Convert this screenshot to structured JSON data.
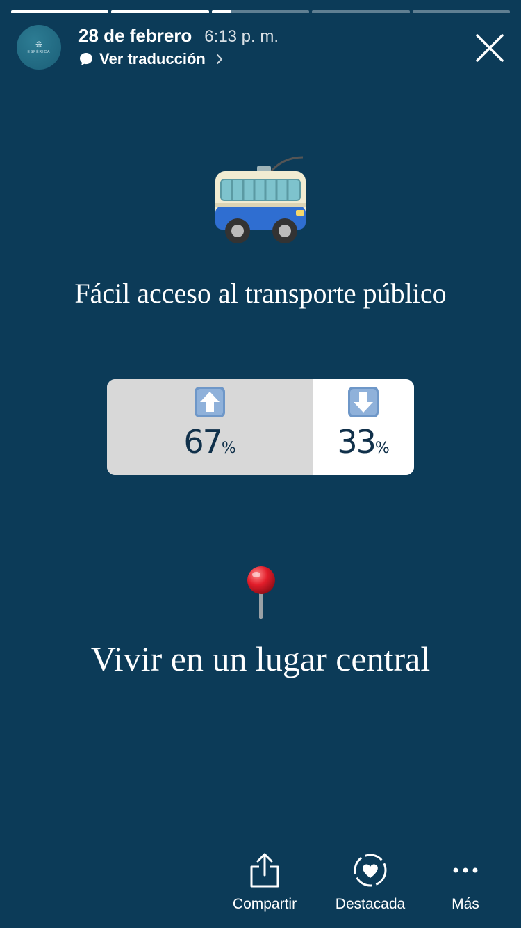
{
  "story": {
    "progress": [
      1,
      1,
      0.2,
      0,
      0
    ],
    "account_logo_text": "ESFÉRICA",
    "date": "28 de febrero",
    "time": "6:13 p. m.",
    "translate_label": "Ver traducción"
  },
  "content": {
    "heading_transport": "Fácil acceso al transporte público",
    "heading_location": "Vivir en un lugar central",
    "poll": {
      "up_value": "67",
      "down_value": "33",
      "percent_symbol": "%",
      "up_fraction": 0.67
    }
  },
  "actions": {
    "share_label": "Compartir",
    "highlight_label": "Destacada",
    "more_label": "Más"
  },
  "icons": [
    "chat-bubble-icon",
    "chevron-right-icon",
    "close-icon",
    "trolleybus-icon",
    "up-arrow-icon",
    "down-arrow-icon",
    "round-pushpin-icon",
    "share-icon",
    "highlight-heart-icon",
    "more-dots-icon"
  ]
}
